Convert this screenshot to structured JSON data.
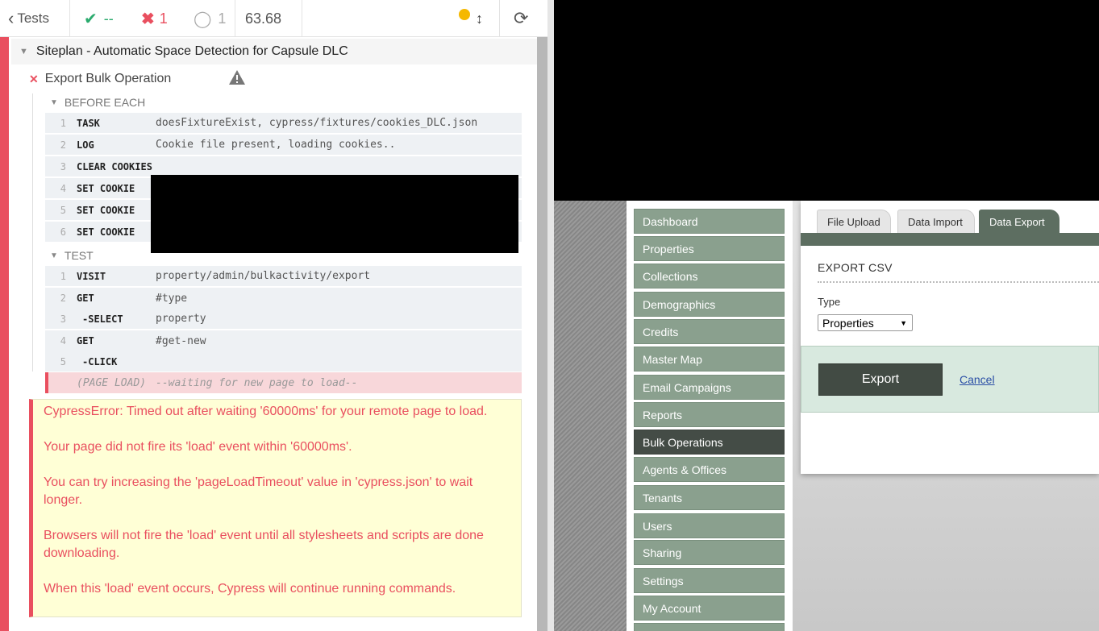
{
  "reporter": {
    "header": {
      "tests_label": "Tests",
      "passed_count": "--",
      "failed_count": "1",
      "pending_count": "1",
      "duration": "63.68",
      "status_color": "#f5b800"
    },
    "suite_title": "Siteplan - Automatic Space Detection for Capsule DLC",
    "test_title": "Export Bulk Operation",
    "before_each": {
      "title": "BEFORE EACH",
      "commands": [
        {
          "num": "1",
          "name": "TASK",
          "message": "doesFixtureExist, cypress/fixtures/cookies_DLC.json"
        },
        {
          "num": "2",
          "name": "LOG",
          "message": "Cookie file present, loading cookies.."
        },
        {
          "num": "3",
          "name": "CLEAR COOKIES",
          "message": ""
        },
        {
          "num": "4",
          "name": "SET COOKIE",
          "message": ""
        },
        {
          "num": "5",
          "name": "SET COOKIE",
          "message": ""
        },
        {
          "num": "6",
          "name": "SET COOKIE",
          "message": ""
        }
      ]
    },
    "test_body": {
      "title": "TEST",
      "commands": [
        {
          "num": "1",
          "name": "VISIT",
          "message": "property/admin/bulkactivity/export"
        },
        {
          "num": "2",
          "name": "GET",
          "message": "#type"
        },
        {
          "num": "3",
          "name": "-SELECT",
          "message": "property"
        },
        {
          "num": "4",
          "name": "GET",
          "message": "#get-new"
        },
        {
          "num": "5",
          "name": "-CLICK",
          "message": ""
        }
      ],
      "page_load": {
        "name": "(PAGE LOAD)",
        "message": "--waiting for new page to load--"
      }
    },
    "error": {
      "line1": "CypressError: Timed out after waiting '60000ms' for your remote page to load.",
      "line2": "Your page did not fire its 'load' event within '60000ms'.",
      "line3": "You can try increasing the 'pageLoadTimeout' value in 'cypress.json' to wait longer.",
      "line4": "Browsers will not fire the 'load' event until all stylesheets and scripts are done downloading.",
      "line5": "When this 'load' event occurs, Cypress will continue running commands."
    }
  },
  "app": {
    "nav": [
      "Dashboard",
      "Properties",
      "Collections",
      "Demographics",
      "Credits",
      "Master Map",
      "Email Campaigns",
      "Reports",
      "Bulk Operations",
      "Agents & Offices",
      "Tenants",
      "Users",
      "Sharing",
      "Settings",
      "My Account"
    ],
    "active_nav": "Bulk Operations",
    "tabs": [
      "File Upload",
      "Data Import",
      "Data Export"
    ],
    "active_tab": "Data Export",
    "section_title": "EXPORT CSV",
    "type_label": "Type",
    "type_selected": "Properties",
    "export_button": "Export",
    "cancel_link": "Cancel"
  }
}
